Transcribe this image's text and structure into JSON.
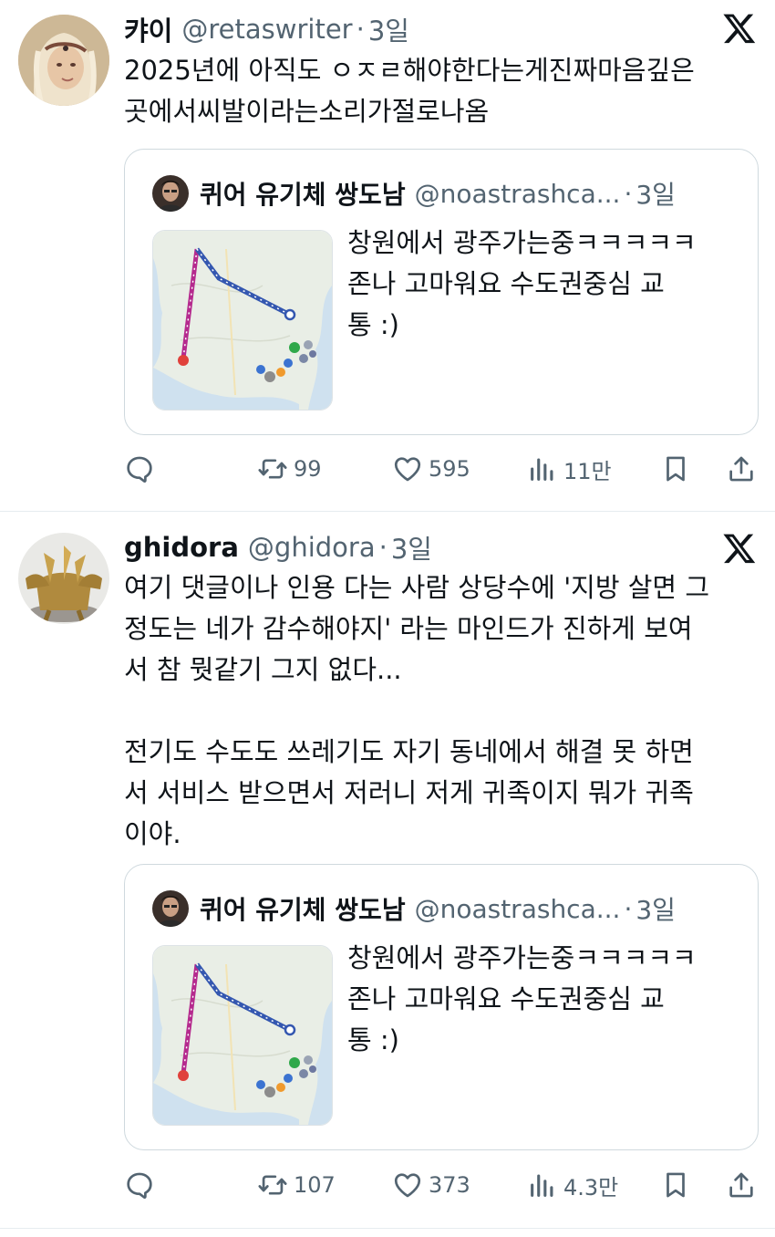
{
  "tweets": [
    {
      "name": "캬이",
      "handle": "@retaswriter",
      "dot": "·",
      "time": "3일",
      "text": "2025년에 아직도 ㅇㅈㄹ해야한다는게진짜마음깊은\n곳에서씨발이라는소리가절로나옴",
      "quote": {
        "name": "퀴어 유기체 쌍도남",
        "handle": "@noastrashca...",
        "dot": "·",
        "time": "3일",
        "text": "창원에서 광주가는중ㅋㅋㅋㅋㅋ\n존나 고마워요 수도권중심 교\n통 :)"
      },
      "actions": {
        "retweets": "99",
        "likes": "595",
        "views": "11만"
      }
    },
    {
      "name": "ghidora",
      "handle": "@ghidora",
      "dot": "·",
      "time": "3일",
      "text": "여기 댓글이나 인용 다는 사람 상당수에 '지방 살면 그\n정도는 네가 감수해야지' 라는 마인드가 진하게 보여\n서 참 뭣같기 그지 없다...\n\n전기도 수도도 쓰레기도 자기 동네에서 해결 못 하면\n서 서비스 받으면서 저러니 저게 귀족이지 뭐가 귀족\n이야.",
      "quote": {
        "name": "퀴어 유기체 쌍도남",
        "handle": "@noastrashca...",
        "dot": "·",
        "time": "3일",
        "text": "창원에서 광주가는중ㅋㅋㅋㅋㅋ\n존나 고마워요 수도권중심 교\n통 :)"
      },
      "actions": {
        "retweets": "107",
        "likes": "373",
        "views": "4.3만"
      }
    }
  ],
  "icons": {
    "reply": "reply-icon",
    "retweet": "retweet-icon",
    "like": "heart-icon",
    "views": "views-icon",
    "bookmark": "bookmark-icon",
    "share": "share-icon",
    "x": "x-logo-icon"
  },
  "colors": {
    "text": "#0f1419",
    "muted": "#536471",
    "border": "#cfd9de"
  }
}
